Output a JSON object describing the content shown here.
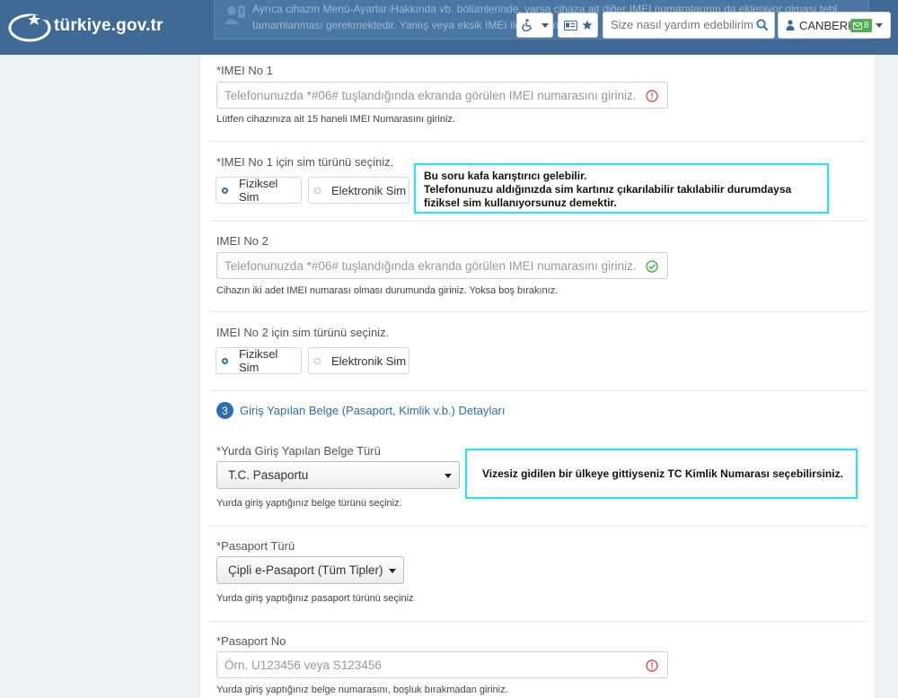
{
  "header": {
    "logo_text": "türkiye.gov.tr",
    "notice_line1": "Ayrıca cihazın Menü-Ayarlar-Hakkında vb. bölümlerinde, varsa cihaza ait diğer IMEI numaralarının da ekleniyor olması tebl",
    "notice_line2": "tamamlanması gerekmektedir. Yanlış veya eksik IMEI ile yapılan",
    "search_placeholder": "Size nasıl yardım edebilirim?",
    "user_name": "CANBERK",
    "mail_count": "8"
  },
  "form": {
    "imei1": {
      "required_mark": "*",
      "label": "IMEI No 1",
      "placeholder": "Telefonunuzda *#06# tuşlandığında ekranda görülen IMEI numarasını giriniz.",
      "help": "Lütfen cihazınıza ait 15 haneli IMEI Numarasını giriniz.",
      "state": "error"
    },
    "sim1": {
      "required_mark": "*",
      "label": "IMEI No 1 için sim türünü seçiniz.",
      "options": [
        "Fiziksel Sim",
        "Elektronik Sim"
      ],
      "selected": "Fiziksel Sim"
    },
    "imei2": {
      "label": "IMEI No 2",
      "placeholder": "Telefonunuzda *#06# tuşlandığında ekranda görülen IMEI numarasını giriniz.",
      "help": "Cihazın iki adet IMEI numarası olması durumunda giriniz. Yoksa boş bırakınız.",
      "state": "valid"
    },
    "sim2": {
      "label": "IMEI No 2 için sim türünü seçiniz.",
      "options": [
        "Fiziksel Sim",
        "Elektronik Sim"
      ],
      "selected": "Fiziksel Sim"
    },
    "section3": {
      "number": "3",
      "title": "Giriş Yapılan Belge (Pasaport, Kimlik v.b.) Detayları"
    },
    "doc_type": {
      "required_mark": "*",
      "label": "Yurda Giriş Yapılan Belge Türü",
      "value": "T.C. Pasaportu",
      "help": "Yurda giriş yaptığınız belge türünü seçiniz."
    },
    "passport_type": {
      "required_mark": "*",
      "label": "Pasaport Türü",
      "value": "Çipli e-Pasaport (Tüm Tipler)",
      "help": "Yurda giriş yaptığınız pasaport türünü seçiniz"
    },
    "passport_no": {
      "required_mark": "*",
      "label": "Pasaport No",
      "placeholder": "Örn. U123456 veya S123456",
      "help": "Yurda giriş yaptığınız belge numarasını, boşluk bırakmadan giriniz.",
      "state": "error"
    }
  },
  "annotations": {
    "sim_note_line1": "Bu soru kafa karıştırıcı gelebilir.",
    "sim_note_line2": "Telefonunuzu aldığınızda sim kartınız çıkarılabilir takılabilir durumdaysa",
    "sim_note_line3": "fiziksel sim kullanıyorsunuz demektir.",
    "doc_note": "Vizesiz gidilen bir ülkeye gittiyseniz TC Kimlik Numarası seçebilirsiniz."
  },
  "colors": {
    "header_bg": "#3f6a96",
    "accent": "#2c6fb0",
    "error": "#d9534f",
    "success": "#4cae4c",
    "annotation_border": "#30dff0"
  }
}
